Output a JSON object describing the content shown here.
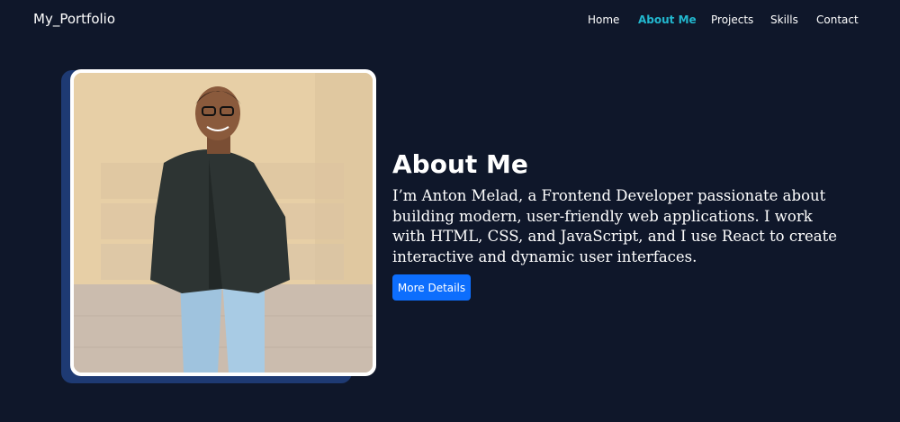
{
  "navbar": {
    "brand": "My_Portfolio",
    "links": [
      {
        "label": "Home",
        "active": false
      },
      {
        "label": "About Me",
        "active": true
      },
      {
        "label": "Projects",
        "active": false
      },
      {
        "label": "Skills",
        "active": false
      },
      {
        "label": "Contact",
        "active": false
      }
    ]
  },
  "about": {
    "title": "About Me",
    "text": "I’m Anton Melad, a Frontend Developer passionate about building modern, user-friendly web applications. I work with HTML, CSS, and JavaScript, and I use React to create interactive and dynamic user interfaces.",
    "button_label": "More Details",
    "photo_icon": "profile-photo"
  },
  "colors": {
    "background": "#0f172a",
    "accent": "#22b8cf",
    "button": "#0d6efd",
    "photo_shadow": "#1e3a73"
  }
}
